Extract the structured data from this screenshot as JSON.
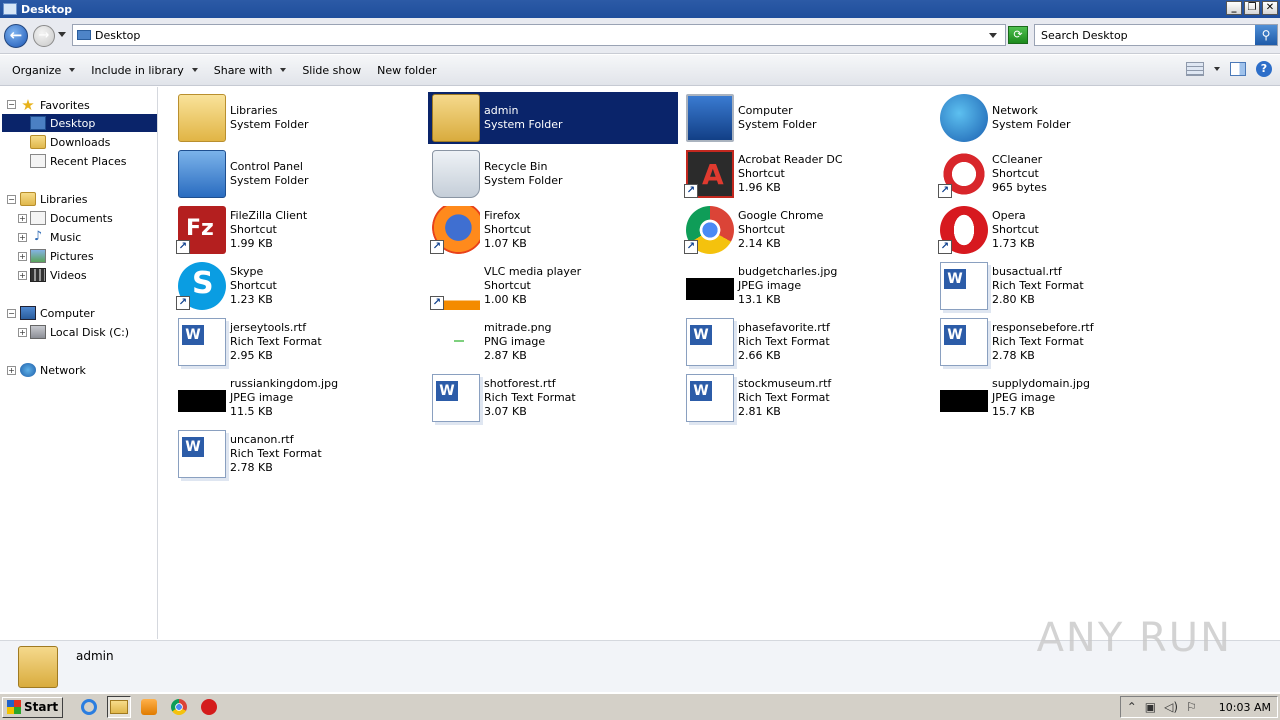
{
  "window": {
    "title": "Desktop"
  },
  "address": {
    "path": "Desktop",
    "search_placeholder": "Search Desktop"
  },
  "toolbar": {
    "organize": "Organize",
    "include_in_library": "Include in library",
    "share_with": "Share with",
    "slide_show": "Slide show",
    "new_folder": "New folder"
  },
  "nav": {
    "favorites": "Favorites",
    "desktop": "Desktop",
    "downloads": "Downloads",
    "recent_places": "Recent Places",
    "libraries": "Libraries",
    "documents": "Documents",
    "music": "Music",
    "pictures": "Pictures",
    "videos": "Videos",
    "computer": "Computer",
    "local_disk": "Local Disk (C:)",
    "network": "Network"
  },
  "items": [
    {
      "name": "Libraries",
      "type": "System Folder",
      "size": "",
      "icon": "libraries-icon"
    },
    {
      "name": "admin",
      "type": "System Folder",
      "size": "",
      "icon": "user-folder-icon",
      "selected": true
    },
    {
      "name": "Computer",
      "type": "System Folder",
      "size": "",
      "icon": "computer-icon"
    },
    {
      "name": "Network",
      "type": "System Folder",
      "size": "",
      "icon": "network-icon"
    },
    {
      "name": "Control Panel",
      "type": "System Folder",
      "size": "",
      "icon": "control-panel-icon"
    },
    {
      "name": "Recycle Bin",
      "type": "System Folder",
      "size": "",
      "icon": "recycle-bin-icon"
    },
    {
      "name": "Acrobat Reader DC",
      "type": "Shortcut",
      "size": "1.96 KB",
      "icon": "acrobat-icon"
    },
    {
      "name": "CCleaner",
      "type": "Shortcut",
      "size": "965 bytes",
      "icon": "ccleaner-icon"
    },
    {
      "name": "FileZilla Client",
      "type": "Shortcut",
      "size": "1.99 KB",
      "icon": "filezilla-icon"
    },
    {
      "name": "Firefox",
      "type": "Shortcut",
      "size": "1.07 KB",
      "icon": "firefox-icon"
    },
    {
      "name": "Google Chrome",
      "type": "Shortcut",
      "size": "2.14 KB",
      "icon": "chrome-icon"
    },
    {
      "name": "Opera",
      "type": "Shortcut",
      "size": "1.73 KB",
      "icon": "opera-icon"
    },
    {
      "name": "Skype",
      "type": "Shortcut",
      "size": "1.23 KB",
      "icon": "skype-icon"
    },
    {
      "name": "VLC media player",
      "type": "Shortcut",
      "size": "1.00 KB",
      "icon": "vlc-icon"
    },
    {
      "name": "budgetcharles.jpg",
      "type": "JPEG image",
      "size": "13.1 KB",
      "icon": "jpeg-icon"
    },
    {
      "name": "busactual.rtf",
      "type": "Rich Text Format",
      "size": "2.80 KB",
      "icon": "rtf-icon"
    },
    {
      "name": "jerseytools.rtf",
      "type": "Rich Text Format",
      "size": "2.95 KB",
      "icon": "rtf-icon"
    },
    {
      "name": "mitrade.png",
      "type": "PNG image",
      "size": "2.87 KB",
      "icon": "png-icon"
    },
    {
      "name": "phasefavorite.rtf",
      "type": "Rich Text Format",
      "size": "2.66 KB",
      "icon": "rtf-icon"
    },
    {
      "name": "responsebefore.rtf",
      "type": "Rich Text Format",
      "size": "2.78 KB",
      "icon": "rtf-icon"
    },
    {
      "name": "russiankingdom.jpg",
      "type": "JPEG image",
      "size": "11.5 KB",
      "icon": "jpeg-icon"
    },
    {
      "name": "shotforest.rtf",
      "type": "Rich Text Format",
      "size": "3.07 KB",
      "icon": "rtf-icon"
    },
    {
      "name": "stockmuseum.rtf",
      "type": "Rich Text Format",
      "size": "2.81 KB",
      "icon": "rtf-icon"
    },
    {
      "name": "supplydomain.jpg",
      "type": "JPEG image",
      "size": "15.7 KB",
      "icon": "jpeg-icon"
    },
    {
      "name": "uncanon.rtf",
      "type": "Rich Text Format",
      "size": "2.78 KB",
      "icon": "rtf-icon"
    }
  ],
  "details": {
    "name": "admin"
  },
  "watermark": "ANY RUN",
  "taskbar": {
    "start": "Start",
    "clock": "10:03 AM"
  }
}
